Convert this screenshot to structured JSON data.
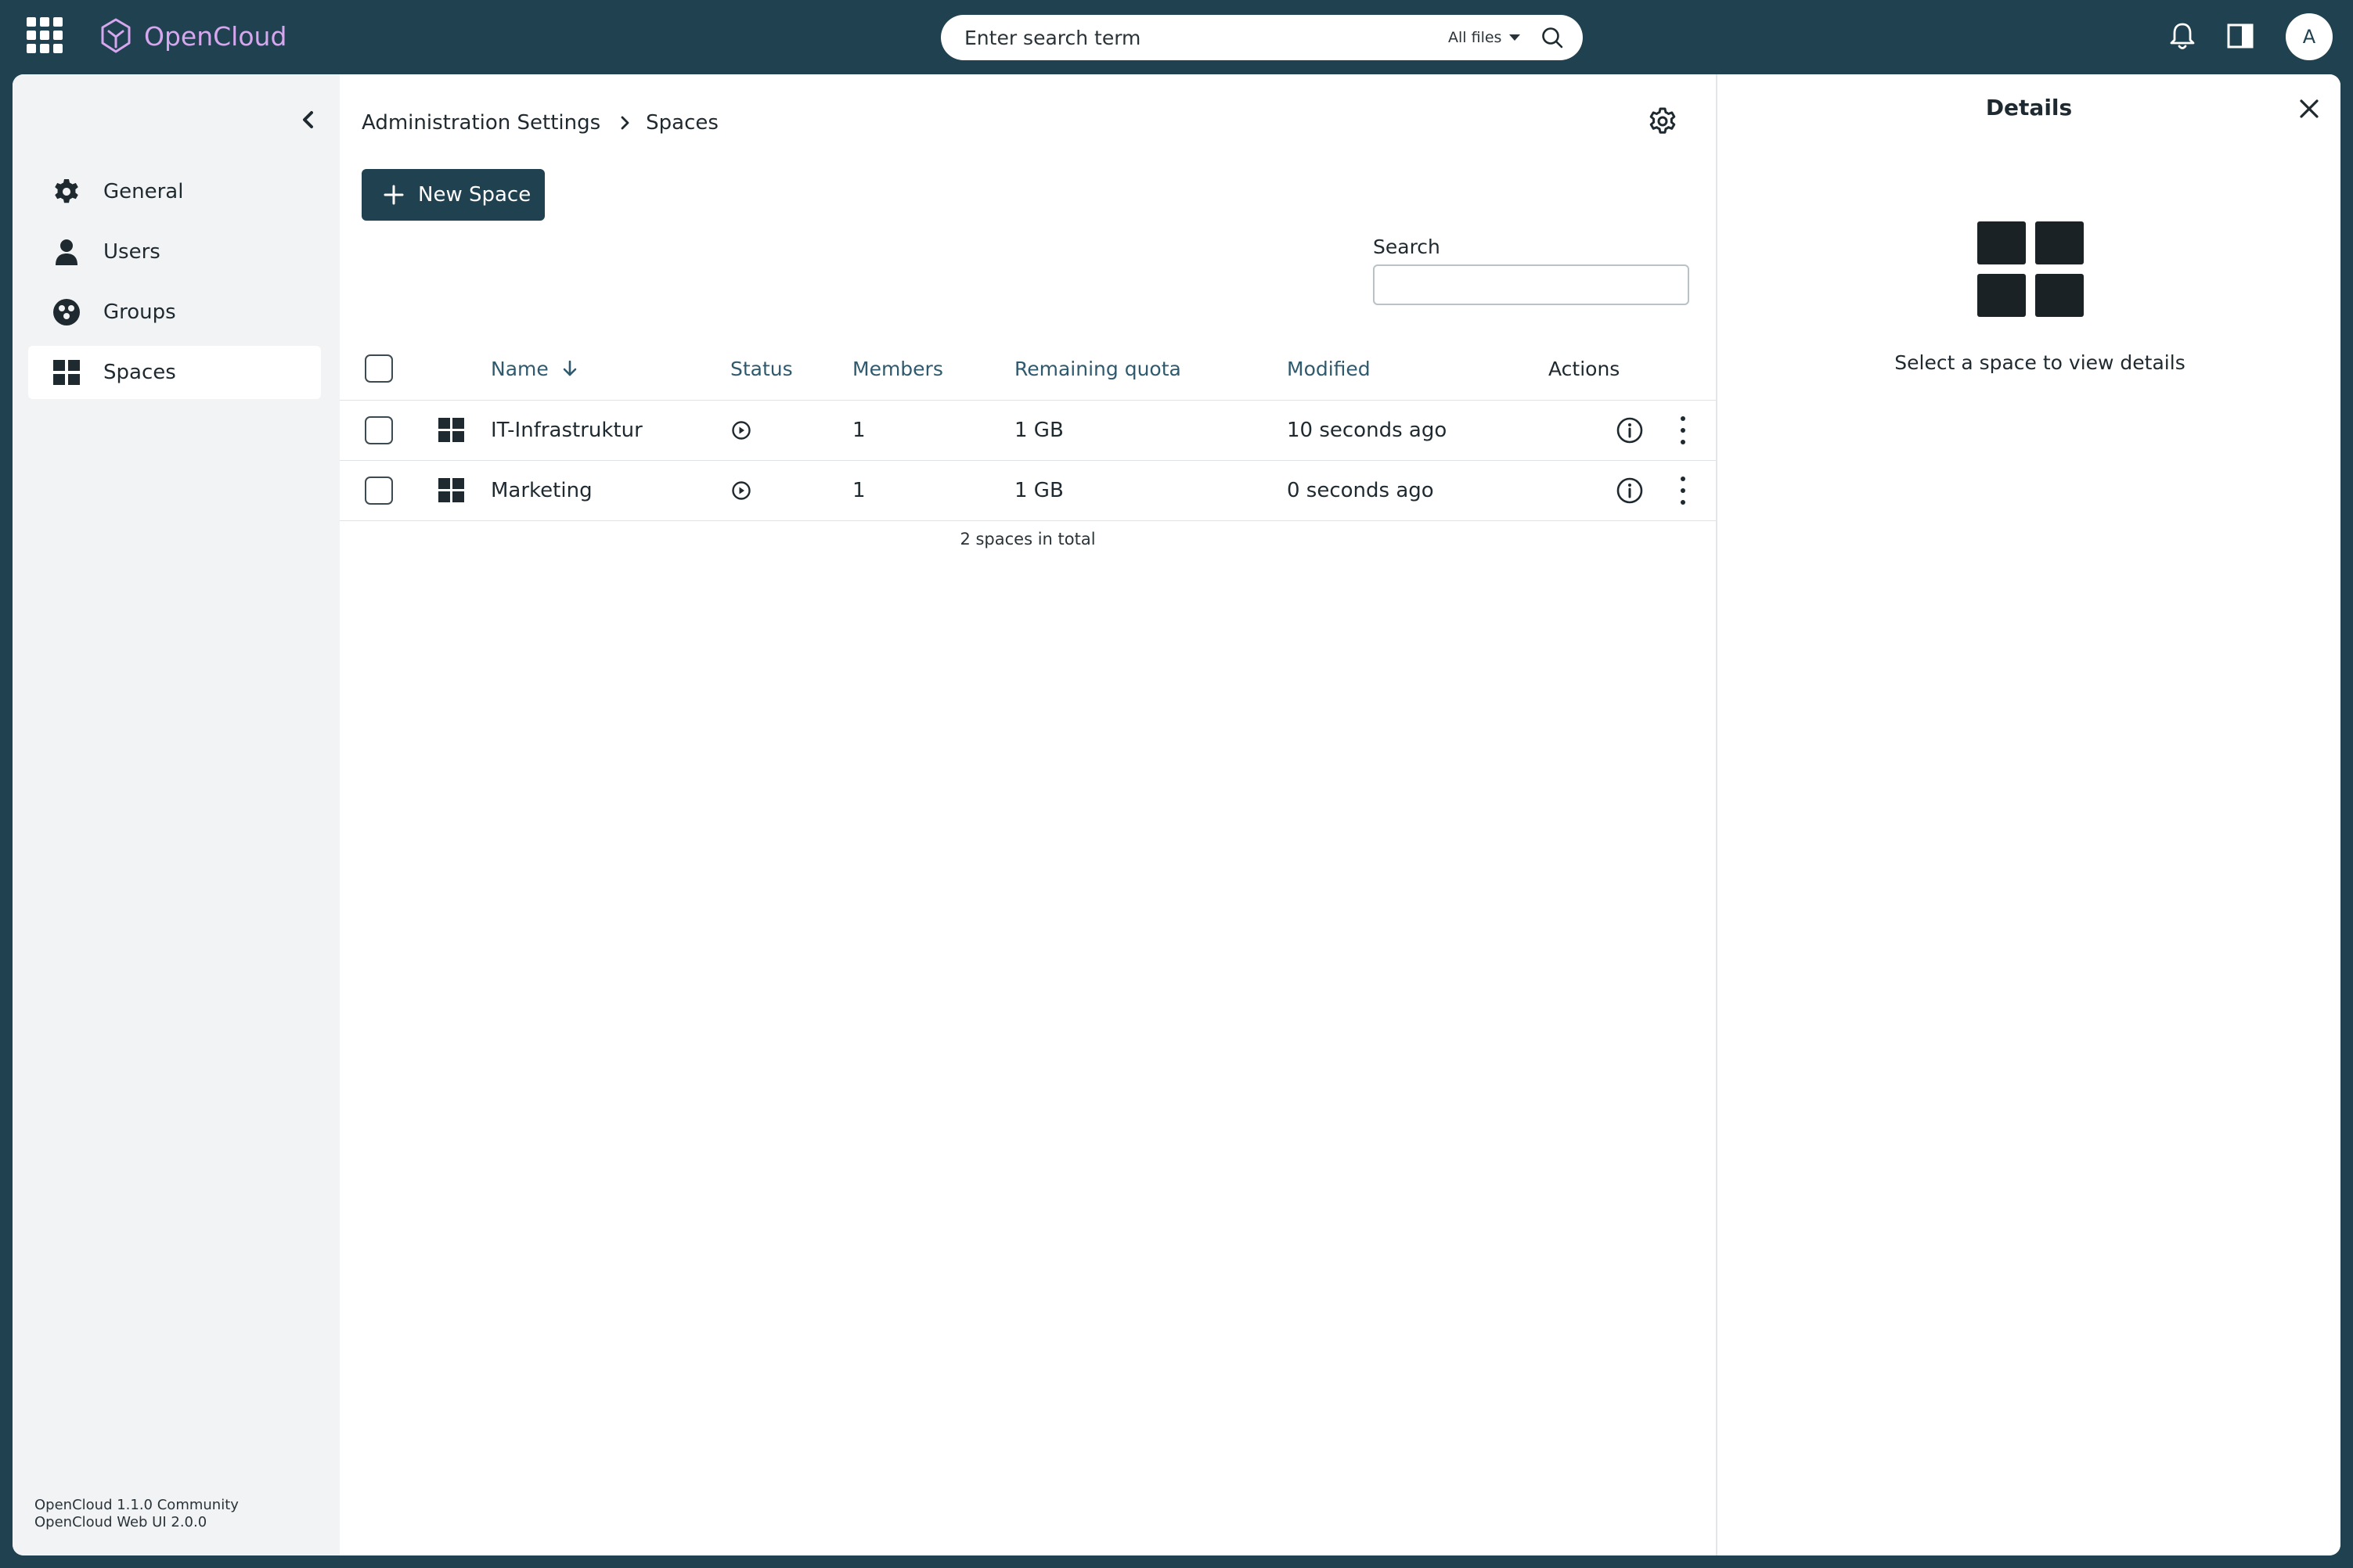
{
  "app": {
    "name": "OpenCloud"
  },
  "search": {
    "placeholder": "Enter search term",
    "scope": "All files"
  },
  "user": {
    "avatar_initial": "A"
  },
  "sidebar": {
    "items": [
      {
        "label": "General",
        "icon": "gear-icon",
        "active": false
      },
      {
        "label": "Users",
        "icon": "user-icon",
        "active": false
      },
      {
        "label": "Groups",
        "icon": "group-icon",
        "active": false
      },
      {
        "label": "Spaces",
        "icon": "grid-icon",
        "active": true
      }
    ],
    "version_line1": "OpenCloud 1.1.0 Community",
    "version_line2": "OpenCloud Web UI 2.0.0"
  },
  "breadcrumb": {
    "parent": "Administration Settings",
    "current": "Spaces"
  },
  "toolbar": {
    "new_space_label": "New Space"
  },
  "filter": {
    "label": "Search",
    "value": ""
  },
  "table": {
    "headers": {
      "name": "Name",
      "status": "Status",
      "members": "Members",
      "quota": "Remaining quota",
      "modified": "Modified",
      "actions": "Actions"
    },
    "sort": {
      "column": "Name",
      "direction": "descending"
    },
    "rows": [
      {
        "name": "IT-Infrastruktur",
        "status": "enabled",
        "members": "1",
        "quota": "1 GB",
        "modified": "10 seconds ago"
      },
      {
        "name": "Marketing",
        "status": "enabled",
        "members": "1",
        "quota": "1 GB",
        "modified": "0 seconds ago"
      }
    ],
    "total": "2 spaces in total"
  },
  "details": {
    "title": "Details",
    "empty_message": "Select a space to view details"
  },
  "colors": {
    "topbar": "#20414f",
    "brand": "#d6a7ef",
    "primary_button": "#20414f",
    "header_text": "#2f5a6e",
    "sidebar_bg": "#f2f3f5"
  }
}
